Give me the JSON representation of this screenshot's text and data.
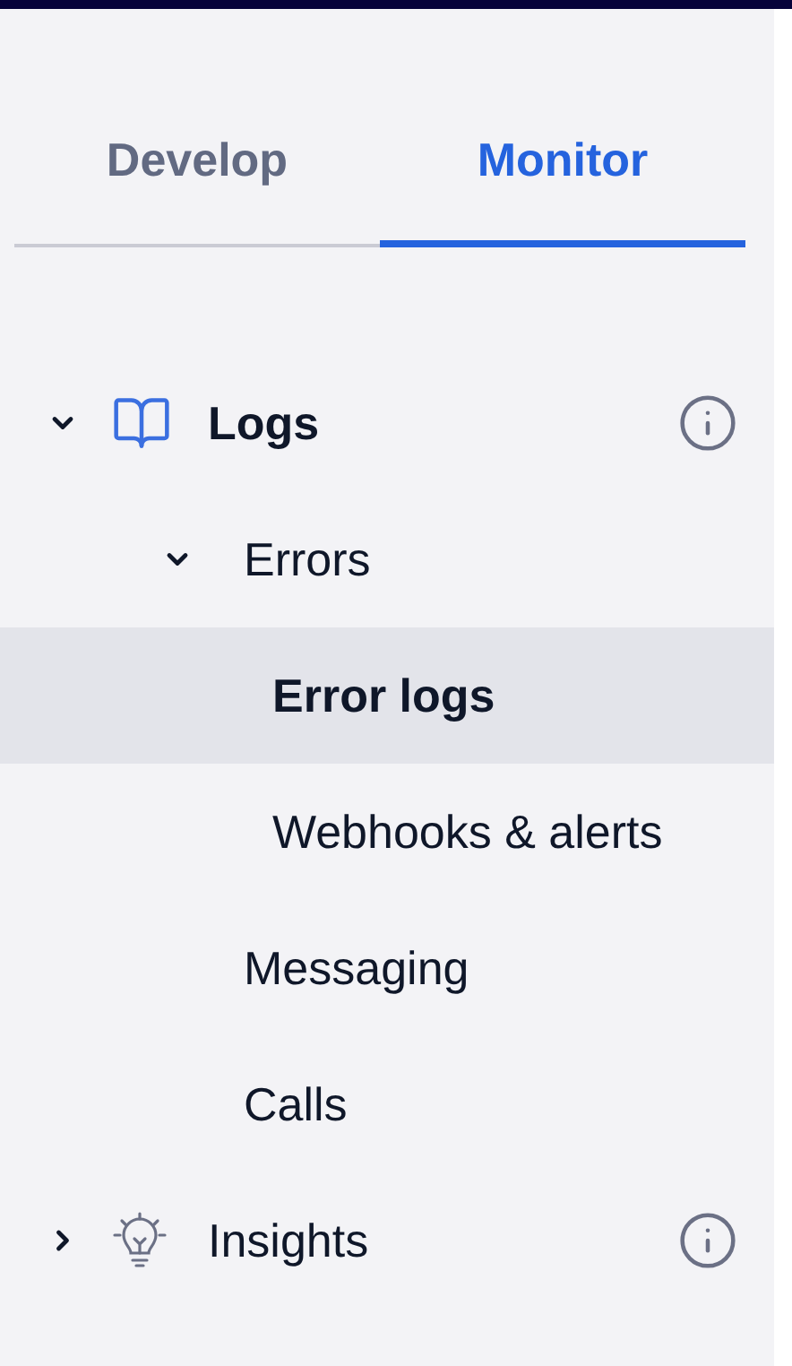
{
  "tabs": [
    {
      "label": "Develop",
      "selected": false
    },
    {
      "label": "Monitor",
      "selected": true
    }
  ],
  "tree": [
    {
      "label": "Logs",
      "kind": "book",
      "expanded": true,
      "active": true,
      "info": true,
      "selected": false,
      "children": [
        {
          "label": "Errors",
          "expanded": true,
          "selected": false,
          "children": [
            {
              "label": "Error logs",
              "selected": true
            },
            {
              "label": "Webhooks & alerts",
              "selected": false
            }
          ]
        },
        {
          "label": "Messaging",
          "selected": false
        },
        {
          "label": "Calls",
          "selected": false
        }
      ]
    },
    {
      "label": "Insights",
      "kind": "bulb",
      "expanded": false,
      "active": false,
      "info": true,
      "selected": false
    }
  ]
}
